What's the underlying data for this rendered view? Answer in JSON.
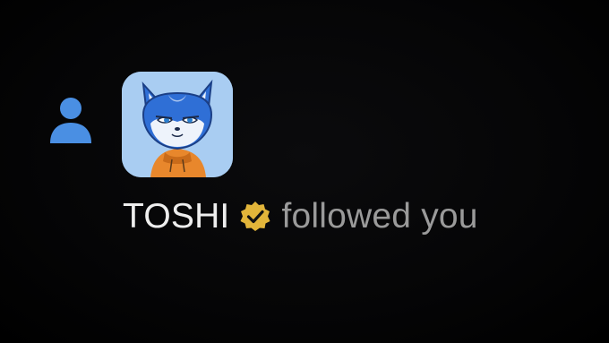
{
  "notification": {
    "type_icon": "person-icon",
    "avatar_icon": "fox-avatar",
    "user_name": "TOSHI",
    "verified_icon": "verified-badge-icon",
    "action_text": "followed you"
  },
  "colors": {
    "background": "#000000",
    "person_icon": "#4a8fe3",
    "name_text": "#eeeeee",
    "action_text": "#9a9a9a",
    "badge_gold": "#e2b53a",
    "avatar_bg": "#a9cdf2"
  }
}
